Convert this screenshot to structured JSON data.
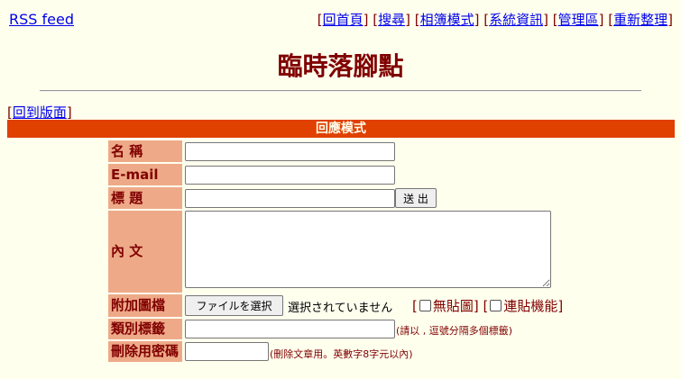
{
  "header": {
    "rss": "RSS feed",
    "nav": [
      {
        "label": "回首頁"
      },
      {
        "label": "搜尋"
      },
      {
        "label": "相簿模式"
      },
      {
        "label": "系統資訊"
      },
      {
        "label": "管理區"
      },
      {
        "label": "重新整理"
      }
    ]
  },
  "title": "臨時落腳點",
  "back_link": "回到版面",
  "banner": "回應模式",
  "form": {
    "name_label": "名 稱",
    "email_label": "E-mail",
    "subject_label": "標 題",
    "submit_label": "送 出",
    "body_label": "內 文",
    "attach_label": "附加圖檔",
    "file_button": "ファイルを選択",
    "file_status": "選択されていません",
    "no_image_label": "無貼圖",
    "link_mode_label": "連貼機能",
    "category_label": "類別標籤",
    "category_note": "(請以 , 逗號分隔多個標籤)",
    "password_label": "刪除用密碼",
    "password_note": "(刪除文章用。英數字8字元以內)"
  },
  "colors": {
    "background": "#FFFFEE",
    "text": "#800000",
    "banner": "#E04000",
    "label_bg": "#EEAA88",
    "link": "#0000EE"
  }
}
